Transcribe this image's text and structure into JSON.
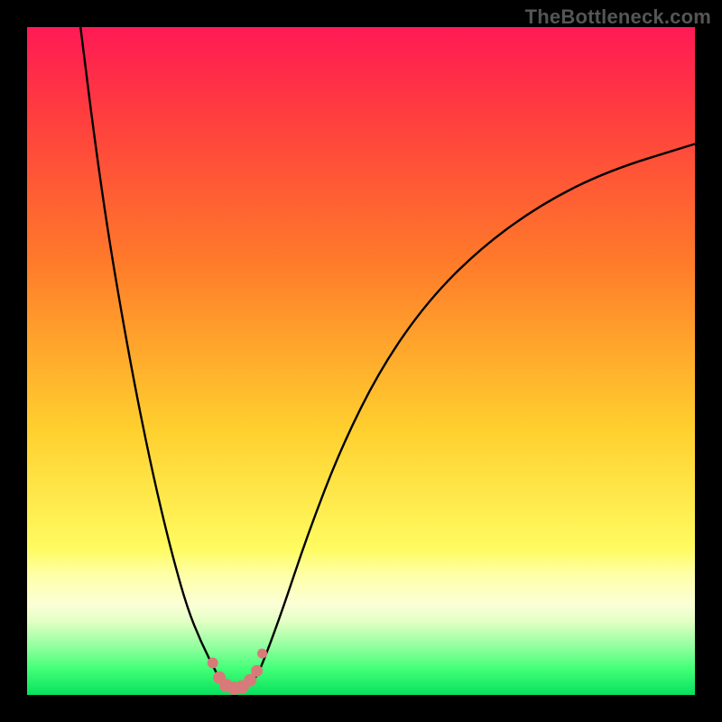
{
  "watermark": "TheBottleneck.com",
  "colors": {
    "background": "#000000",
    "gradient_top": "#ff1a55",
    "gradient_mid_upper": "#ff7a2a",
    "gradient_mid": "#ffcf2e",
    "gradient_lower": "#ffffa7",
    "gradient_bottom": "#07e25d",
    "curve_stroke": "#000000",
    "marker_fill": "#d97a7a"
  },
  "chart_data": {
    "type": "line",
    "title": "",
    "xlabel": "",
    "ylabel": "",
    "xlim": [
      0,
      100
    ],
    "ylim": [
      0,
      100
    ],
    "annotations": [],
    "series": [
      {
        "name": "left-branch",
        "x": [
          8,
          10,
          12,
          14,
          16,
          18,
          20,
          22,
          24,
          26,
          28.5
        ],
        "values": [
          100,
          84,
          70,
          58,
          47,
          37,
          28,
          20,
          13,
          8,
          3
        ]
      },
      {
        "name": "valley",
        "x": [
          28.5,
          29.5,
          31,
          32.5,
          34,
          35
        ],
        "values": [
          3,
          1.3,
          0.9,
          1.1,
          2.2,
          4
        ]
      },
      {
        "name": "right-branch",
        "x": [
          35,
          38,
          42,
          47,
          53,
          60,
          68,
          77,
          87,
          100
        ],
        "values": [
          4,
          12,
          24,
          37,
          49,
          59,
          67,
          73.5,
          78.5,
          82.5
        ]
      }
    ],
    "markers": {
      "name": "valley-markers",
      "x": [
        27.8,
        28.8,
        29.8,
        31.0,
        32.2,
        33.4,
        34.4,
        35.2
      ],
      "values": [
        4.8,
        2.6,
        1.4,
        1.0,
        1.2,
        2.2,
        3.6,
        6.2
      ],
      "r": [
        6,
        7,
        7.5,
        7.5,
        7.5,
        7,
        6.5,
        5.5
      ]
    }
  }
}
